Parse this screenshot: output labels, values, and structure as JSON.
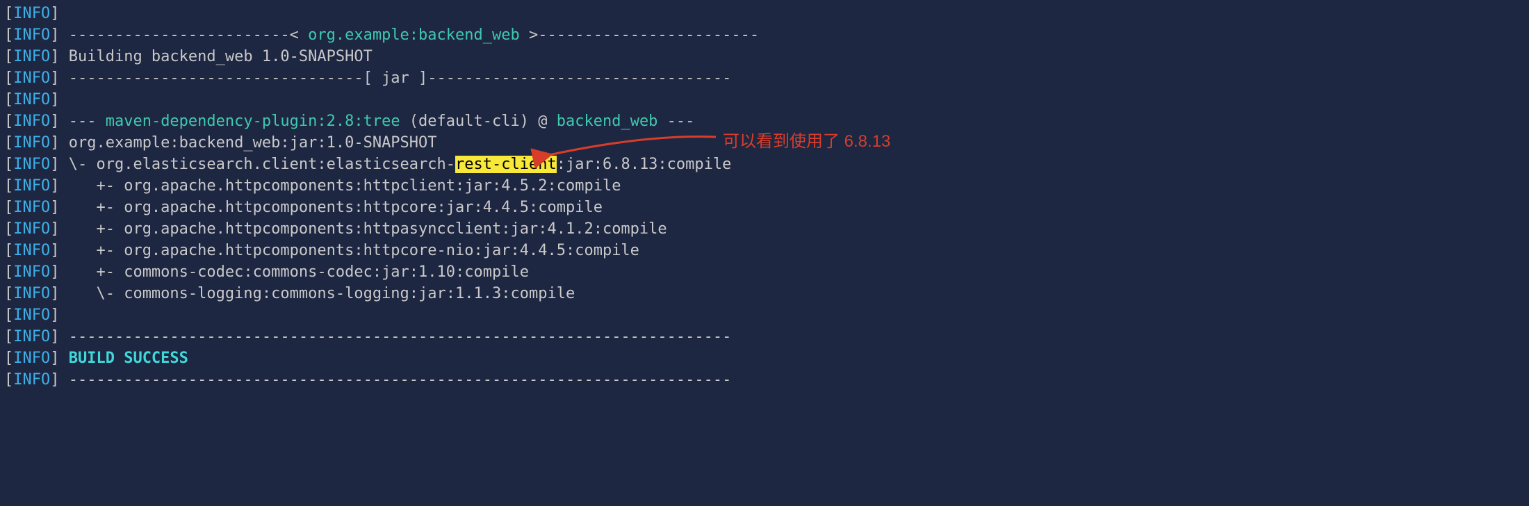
{
  "prefix": {
    "lb": "[",
    "tag": "INFO",
    "rb": "]"
  },
  "lines": {
    "l1_left": " ------------------------< ",
    "l1_mid": "org.example:backend_web",
    "l1_right": " >------------------------",
    "l2": " Building backend_web 1.0-SNAPSHOT",
    "l3": " --------------------------------[ jar ]---------------------------------",
    "l5a": " --- ",
    "l5b": "maven-dependency-plugin:2.8:tree",
    "l5c": " (default-cli) @ ",
    "l5d": "backend_web",
    "l5e": " ---",
    "l6": " org.example:backend_web:jar:1.0-SNAPSHOT",
    "l7a": " \\- org.elasticsearch.client:elasticsearch-",
    "l7b": "rest-client",
    "l7c": ":jar:6.8.13:compile",
    "l8": "    +- org.apache.httpcomponents:httpclient:jar:4.5.2:compile",
    "l9": "    +- org.apache.httpcomponents:httpcore:jar:4.4.5:compile",
    "l10": "    +- org.apache.httpcomponents:httpasyncclient:jar:4.1.2:compile",
    "l11": "    +- org.apache.httpcomponents:httpcore-nio:jar:4.4.5:compile",
    "l12": "    +- commons-codec:commons-codec:jar:1.10:compile",
    "l13": "    \\- commons-logging:commons-logging:jar:1.1.3:compile",
    "l15": " ------------------------------------------------------------------------",
    "l16": " BUILD SUCCESS",
    "l17": " ------------------------------------------------------------------------"
  },
  "annotation": {
    "text": "可以看到使用了 6.8.13",
    "color": "#d93d2a"
  }
}
